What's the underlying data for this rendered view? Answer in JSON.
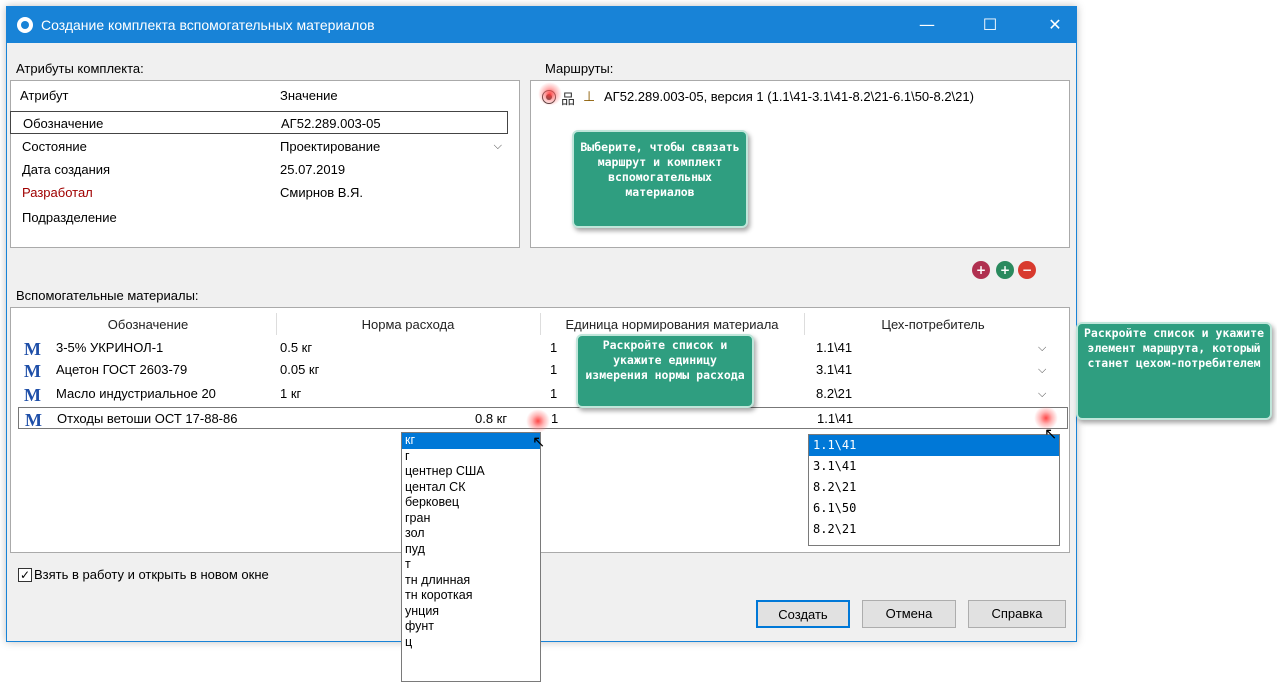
{
  "window": {
    "title": "Создание комплекта вспомогательных материалов"
  },
  "titlebar": {
    "minimize": "—",
    "maximize": "☐",
    "close": "✕"
  },
  "attributes": {
    "section_label": "Атрибуты комплекта:",
    "col_attr": "Атрибут",
    "col_value": "Значение",
    "rows": [
      {
        "name": "Обозначение",
        "value": "АГ52.289.003-05"
      },
      {
        "name": "Состояние",
        "value": "Проектирование"
      },
      {
        "name": "Дата создания",
        "value": "25.07.2019"
      },
      {
        "name": "Разработал",
        "value": "Смирнов В.Я."
      },
      {
        "name": "Подразделение",
        "value": ""
      }
    ]
  },
  "routes": {
    "section_label": "Маршруты:",
    "item": "АГ52.289.003-05, версия 1 (1.1\\41-3.1\\41-8.2\\21-6.1\\50-8.2\\21)"
  },
  "callouts": {
    "route_hint": "Выберите, чтобы связать маршрут и комплект вспомогательных материалов",
    "unit_hint": "Раскройте список и укажите единицу измерения нормы расхода",
    "shop_hint": "Раскройте список и укажите элемент маршрута, который станет цехом-потребителем"
  },
  "materials": {
    "section_label": "Вспомогательные материалы:",
    "columns": [
      "Обозначение",
      "Норма расхода",
      "Единица нормирования материала",
      "Цех-потребитель"
    ],
    "rows": [
      {
        "name": "3-5% УКРИНОЛ-1",
        "norm": "0.5 кг",
        "unit": "1",
        "shop": "1.1\\41"
      },
      {
        "name": "Ацетон ГОСТ 2603-79",
        "norm": "0.05 кг",
        "unit": "1",
        "shop": "3.1\\41"
      },
      {
        "name": "Масло индустриальное 20",
        "norm": "1 кг",
        "unit": "1",
        "shop": "8.2\\21"
      },
      {
        "name": "Отходы ветоши ОСТ 17-88-86",
        "norm": "0.8 кг",
        "unit": "1",
        "shop": "1.1\\41"
      }
    ],
    "material_icon": "M"
  },
  "unit_dropdown": [
    "кг",
    "г",
    "центнер США",
    "центал СК",
    "берковец",
    "гран",
    "зол",
    "пуд",
    "т",
    "тн длинная",
    "тн короткая",
    "унция",
    "фунт",
    "ц"
  ],
  "shop_dropdown": [
    "1.1\\41",
    "3.1\\41",
    "8.2\\21",
    "6.1\\50",
    "8.2\\21"
  ],
  "footer": {
    "checkbox_label": "Взять в работу и открыть в новом окне",
    "checkbox_mark": "✓",
    "create": "Создать",
    "cancel": "Отмена",
    "help": "Справка"
  },
  "icons": {
    "chevron": "⌵",
    "tree": "品",
    "stamp": "⊥",
    "add_red": "+",
    "add_green": "+",
    "remove": "−",
    "cursor": "↖"
  },
  "colors": {
    "accent": "#1883d7",
    "callout": "#2f9e80",
    "selection": "#0078d7"
  }
}
